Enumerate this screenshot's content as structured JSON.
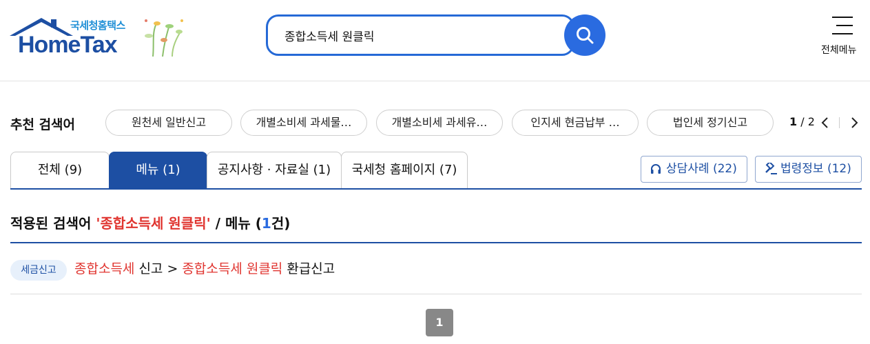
{
  "header": {
    "logo_sub": "국세청홈택스",
    "logo_main": "HomeTax",
    "search_value": "종합소득세 원클릭",
    "menu_label": "전체메뉴"
  },
  "recommend": {
    "title": "추천 검색어",
    "chips": [
      "원천세 일반신고",
      "개별소비세 과세물…",
      "개별소비세 과세유…",
      "인지세 현금납부 …",
      "법인세 정기신고"
    ],
    "page_current": "1",
    "page_total": "/ 2"
  },
  "tabs": [
    {
      "label": "전체 (9)"
    },
    {
      "label": "메뉴 (1)"
    },
    {
      "label": "공지사항 · 자료실 (1)"
    },
    {
      "label": "국세청 홈페이지 (7)"
    }
  ],
  "side_buttons": {
    "consult": "상담사례 (22)",
    "law": "법령정보 (12)"
  },
  "applied": {
    "prefix": "적용된 검색어 ",
    "keyword": "'종합소득세 원클릭'",
    "mid": " / 메뉴 (",
    "count": "1",
    "suffix": "건)"
  },
  "result": {
    "badge": "세금신고",
    "part1": "종합소득세",
    "part2": " 신고 > ",
    "part3": "종합소득세 원클릭",
    "part4": " 환급신고"
  },
  "pagination": {
    "current": "1"
  },
  "colors": {
    "brand": "#1d4fa3",
    "accent": "#2a6be0",
    "highlight": "#e0342f"
  }
}
